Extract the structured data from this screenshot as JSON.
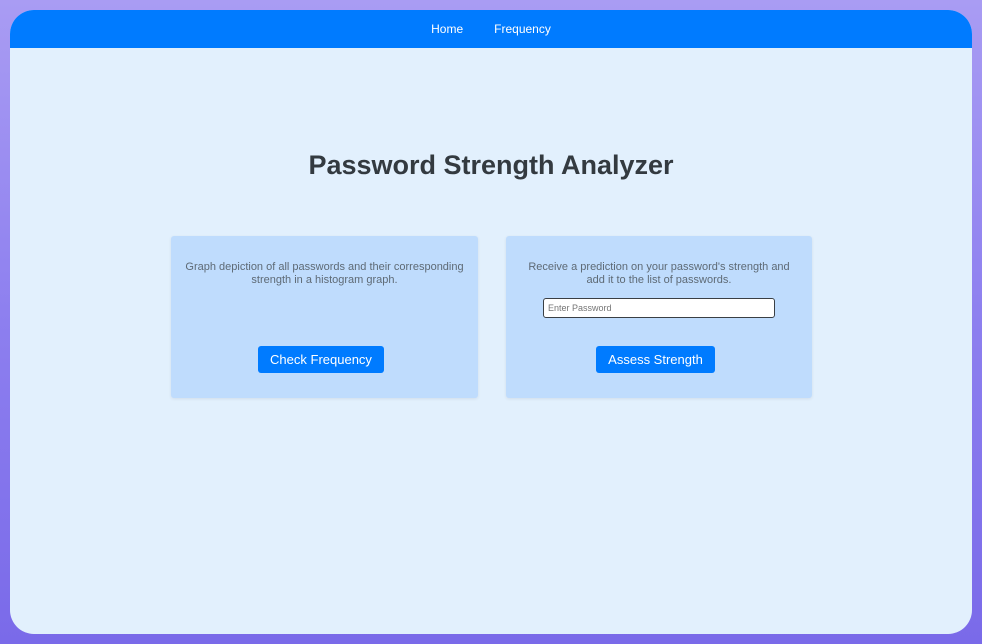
{
  "nav": {
    "links": [
      "Home",
      "Frequency"
    ]
  },
  "page": {
    "title": "Password Strength Analyzer"
  },
  "cards": {
    "frequency": {
      "description": "Graph depiction of all passwords and their corresponding strength in a histogram graph.",
      "button_label": "Check Frequency"
    },
    "strength": {
      "description": "Receive a prediction on your password's strength and add it to the list of passwords.",
      "input_placeholder": "Enter Password",
      "input_value": "",
      "button_label": "Assess Strength"
    }
  },
  "colors": {
    "primary": "#007bff",
    "page_background": "#e2f0fd",
    "card_background": "#bfdcfd",
    "frame_gradient": "#8d7fef"
  }
}
